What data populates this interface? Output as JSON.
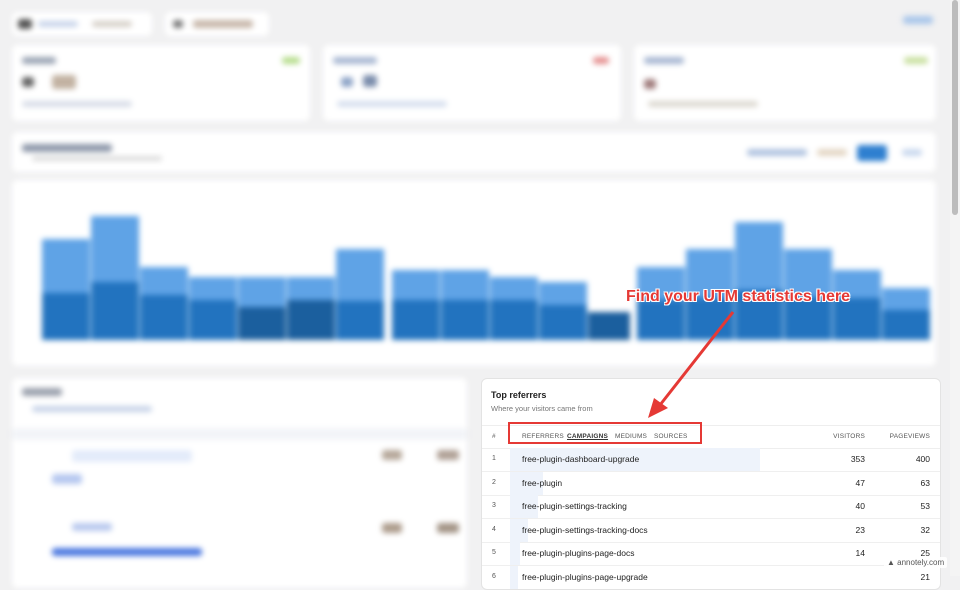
{
  "referrers": {
    "title": "Top referrers",
    "subtitle": "Where your visitors came from",
    "col_rank": "#",
    "tabs": [
      {
        "label": "Referrers",
        "active": false
      },
      {
        "label": "Campaigns",
        "active": true
      },
      {
        "label": "Mediums",
        "active": false
      },
      {
        "label": "Sources",
        "active": false
      }
    ],
    "col_visitors": "VISITORS",
    "col_pageviews": "PAGEVIEWS",
    "rows": [
      {
        "rank": "1",
        "name": "free-plugin-dashboard-upgrade",
        "visitors": "353",
        "pageviews": "400",
        "share": 1.0
      },
      {
        "rank": "2",
        "name": "free-plugin",
        "visitors": "47",
        "pageviews": "63",
        "share": 0.13
      },
      {
        "rank": "3",
        "name": "free-plugin-settings-tracking",
        "visitors": "40",
        "pageviews": "53",
        "share": 0.11
      },
      {
        "rank": "4",
        "name": "free-plugin-settings-tracking-docs",
        "visitors": "23",
        "pageviews": "32",
        "share": 0.07
      },
      {
        "rank": "5",
        "name": "free-plugin-plugins-page-docs",
        "visitors": "14",
        "pageviews": "25",
        "share": 0.04
      },
      {
        "rank": "6",
        "name": "free-plugin-plugins-page-upgrade",
        "visitors": "",
        "pageviews": "21",
        "share": 0.03
      }
    ]
  },
  "annotation": {
    "callout": "Find your UTM statistics here",
    "color": "#e53935"
  },
  "watermark": "annotely.com",
  "colors": {
    "bar_light": "#5fa3e6",
    "bar_dark": "#2273bf",
    "bar_darker": "#1b5f9e",
    "accent_green": "#8bc34a",
    "accent_red": "#e57373"
  }
}
